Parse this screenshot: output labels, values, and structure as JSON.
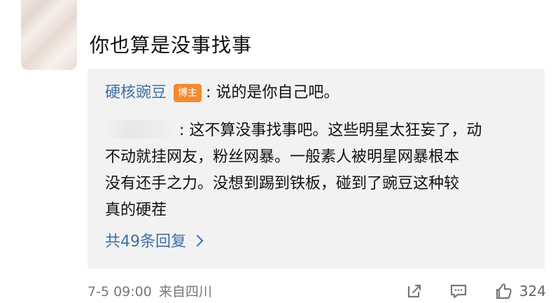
{
  "comment": {
    "text": "你也算是没事找事"
  },
  "reply_box": {
    "first_reply": {
      "author": "硬核豌豆",
      "badge": "博主",
      "text": ": 说的是你自己吧。"
    },
    "second_reply": {
      "lines": [
        ": 这不算没事找事吧。这些明星太狂妄了，动",
        "不动就挂网友，粉丝网暴。一般素人被明星网暴根本",
        "没有还手之力。没想到踢到铁板，碰到了豌豆这种较",
        "真的硬茬"
      ]
    },
    "more_replies_label": "共49条回复"
  },
  "footer": {
    "timestamp": "7-5 09:00",
    "source": "来自四川",
    "like_count": "324"
  },
  "colors": {
    "link_blue": "#3d6fa5",
    "badge_orange": "#f28a2f",
    "reply_bg": "#f2f2f2",
    "meta_gray": "#777777"
  },
  "icons": {
    "share": "share-icon",
    "comment": "comment-icon",
    "like": "like-icon"
  }
}
